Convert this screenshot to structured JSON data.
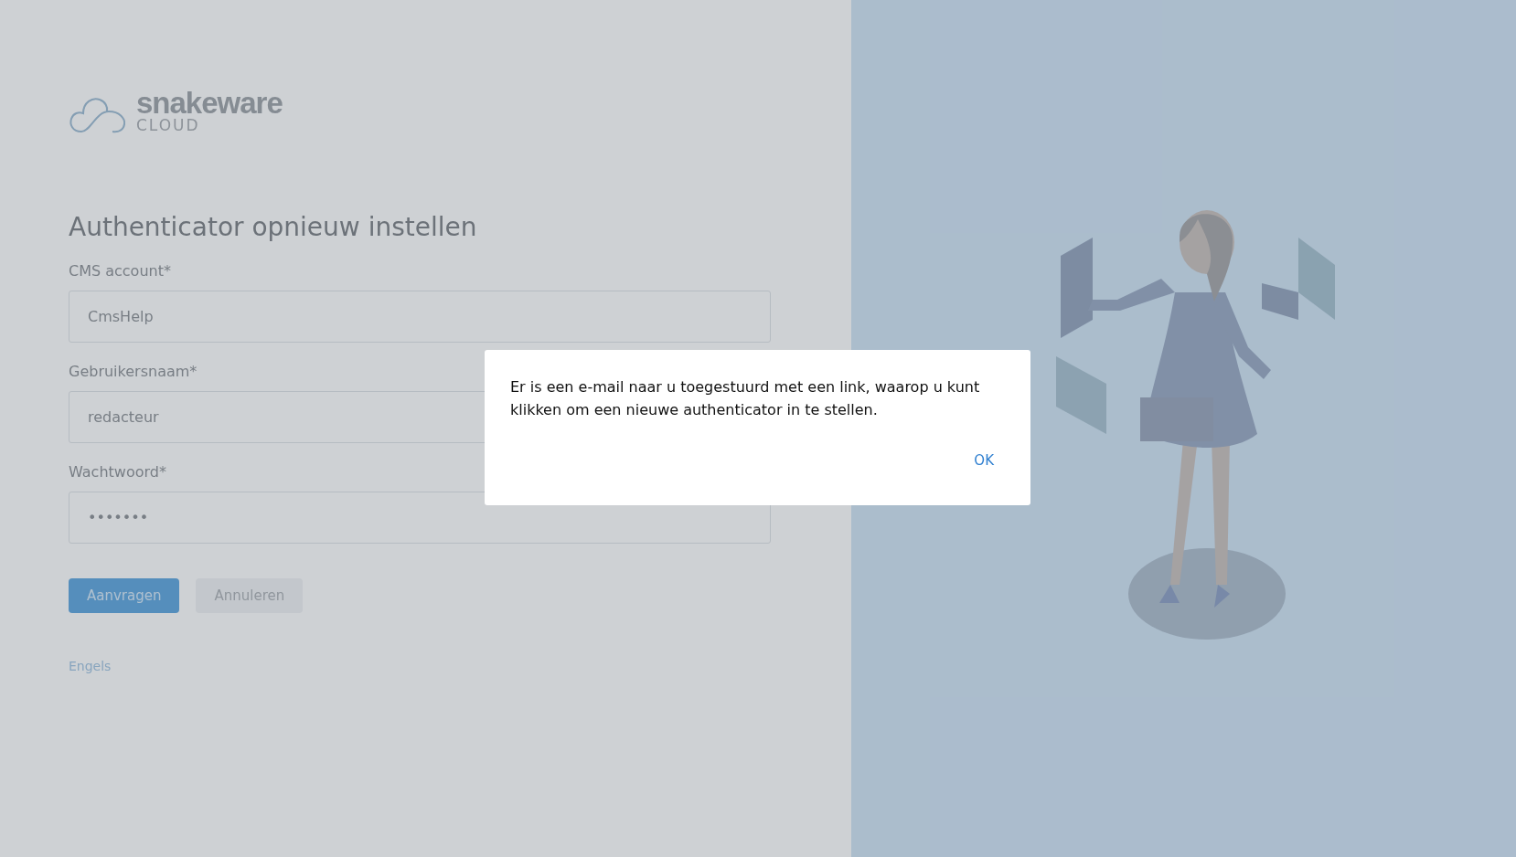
{
  "logo": {
    "name": "snakeware",
    "subtitle": "CLOUD"
  },
  "title": "Authenticator opnieuw instellen",
  "fields": [
    {
      "label": "CMS account*",
      "value": "CmsHelp"
    },
    {
      "label": "Gebruikersnaam*",
      "value": "redacteur"
    },
    {
      "label": "Wachtwoord*",
      "value": "•••••••"
    }
  ],
  "buttons": [
    {
      "label": "Aanvragen",
      "kind": "primary"
    },
    {
      "label": "Annuleren",
      "kind": "secondary"
    }
  ],
  "language_link": "Engels",
  "dialog": {
    "message": "Er is een e-mail naar u toegestuurd met een link, waarop u kunt klikken om een nieuwe authenticator in te stellen.",
    "button": "OK"
  }
}
